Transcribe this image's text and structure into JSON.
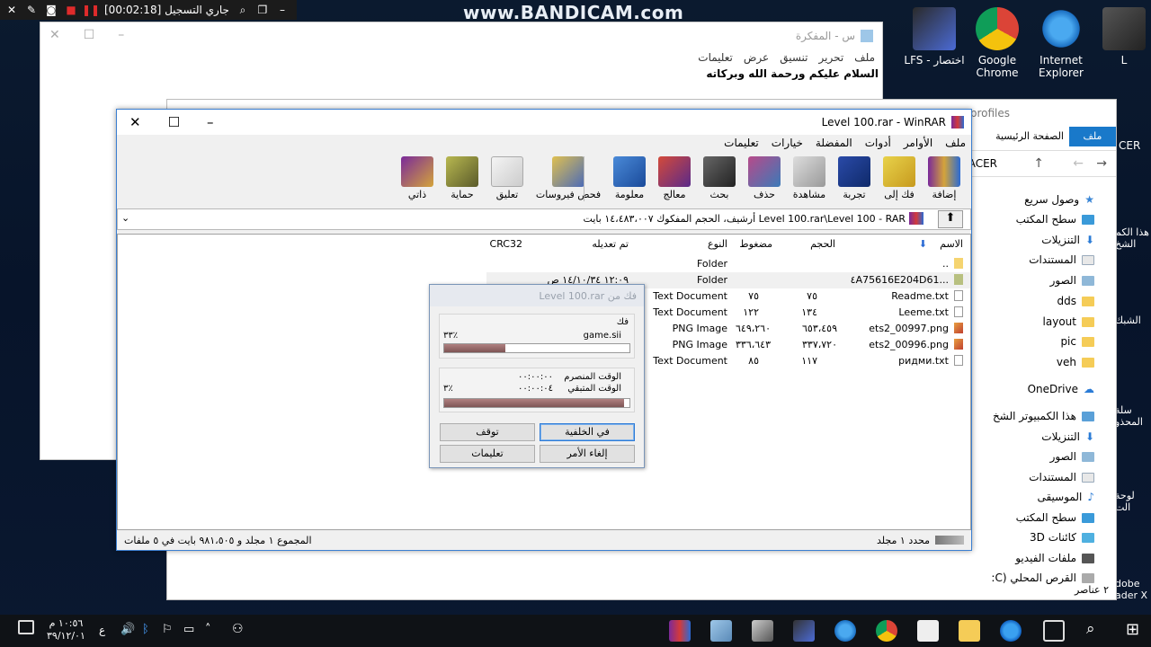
{
  "bandicam": {
    "status": "[00:02:18] جاري التسجيل"
  },
  "watermark": "www.BANDICAM.com",
  "desktop_icons": [
    {
      "label": "L"
    },
    {
      "label": "Internet Explorer"
    },
    {
      "label": "Google Chrome"
    },
    {
      "label": "LFS - اختصار"
    }
  ],
  "right_edge_icons": [
    "CER",
    "هذا الكم الشخ",
    "الشبك",
    "سلة المحذو",
    "لوحة الت",
    "dobe ader X"
  ],
  "notepad": {
    "title": "س - المفكرة",
    "menu": [
      "ملف",
      "تحرير",
      "تنسيق",
      "عرض",
      "تعليمات"
    ],
    "content": "السلام عليكم ورحمة الله وبركاته"
  },
  "explorer": {
    "title_snippet": "profiles",
    "ribbon_tabs": [
      "ملف",
      "الصفحة الرئيسية"
    ],
    "address": "ACER",
    "quick_access": "وصول سريع",
    "nav": [
      {
        "label": "سطح المكتب"
      },
      {
        "label": "التنزيلات"
      },
      {
        "label": "المستندات"
      },
      {
        "label": "الصور"
      },
      {
        "label": "dds"
      },
      {
        "label": "layout"
      },
      {
        "label": "pic"
      },
      {
        "label": "veh"
      },
      {
        "label": "OneDrive"
      },
      {
        "label": "هذا الكمبيوتر الشخ"
      },
      {
        "label": "التنزيلات"
      },
      {
        "label": "الصور"
      },
      {
        "label": "المستندات"
      },
      {
        "label": "الموسيقى"
      },
      {
        "label": "سطح المكتب"
      },
      {
        "label": "كائنات 3D"
      },
      {
        "label": "ملفات الفيديو"
      },
      {
        "label": "القرص المحلي (C:"
      }
    ],
    "status": "٢ عناصر"
  },
  "winrar": {
    "title": "Level 100.rar - WinRAR",
    "menu": [
      "ملف",
      "الأوامر",
      "أدوات",
      "المفضلة",
      "خيارات",
      "تعليمات"
    ],
    "toolbar": [
      "إضافة",
      "فك إلى",
      "تجربة",
      "مشاهدة",
      "حذف",
      "بحث",
      "معالج",
      "معلومة",
      "فحص فيروسات",
      "تعليق",
      "حماية",
      "ذاتي"
    ],
    "address": "Level 100.rar\\Level 100 - RAR أرشيف، الحجم المفكوك ١٤،٤٨٣،٠٠٧ بايت",
    "columns": {
      "name": "الاسم",
      "size": "الحجم",
      "packed": "مضغوط",
      "type": "النوع",
      "modified": "تم تعديله",
      "crc": "CRC32"
    },
    "rows": [
      {
        "name": "..",
        "size": "",
        "packed": "",
        "type": "Folder",
        "modified": "",
        "crc": ""
      },
      {
        "name": "...٤A75616E204D61",
        "size": "",
        "packed": "",
        "type": "Folder",
        "modified": "١٢:٠٩ ١٤/١٠/٣٤ ص",
        "crc": ""
      },
      {
        "name": "Readme.txt",
        "size": "٧٥",
        "packed": "٧٥",
        "type": "Text Document",
        "modified": "",
        "crc": ""
      },
      {
        "name": "Leeme.txt",
        "size": "١٣٤",
        "packed": "١٢٢",
        "type": "Text Document",
        "modified": "",
        "crc": ""
      },
      {
        "name": "ets2_00997.png",
        "size": "٦٥٣،٤٥٩",
        "packed": "٦٤٩،٢٦٠",
        "type": "PNG Image",
        "modified": "",
        "crc": ""
      },
      {
        "name": "ets2_00996.png",
        "size": "٣٣٧،٧٢٠",
        "packed": "٣٣٦،٦٤٣",
        "type": "PNG Image",
        "modified": "",
        "crc": ""
      },
      {
        "name": "ридми.txt",
        "size": "١١٧",
        "packed": "٨٥",
        "type": "Text Document",
        "modified": "",
        "crc": ""
      }
    ],
    "status_left": "المجموع ١ مجلد و ٩٨١،٥٠٥ بايت في ٥ ملفات",
    "status_right": "محدد ١ مجلد"
  },
  "extract_dialog": {
    "title": "فك من Level 100.rar",
    "label": "فك",
    "file": "game.sii",
    "file_percent": "٣٣٪",
    "file_progress": 0.33,
    "elapsed_label": "الوقت المنصرم",
    "elapsed": "٠٠:٠٠:٠٠",
    "remaining_label": "الوقت المتبقي",
    "remaining": "٠٠:٠٠:٠٤",
    "total_percent": "٣٪",
    "total_progress": 0.97,
    "buttons": {
      "background": "في الخلفية",
      "pause": "توقف",
      "cancel": "إلغاء الأمر",
      "help": "تعليمات"
    }
  },
  "taskbar": {
    "time": "١٠:٥٦ م",
    "date": "٣٩/١٢/٠١",
    "lang": "ع"
  }
}
